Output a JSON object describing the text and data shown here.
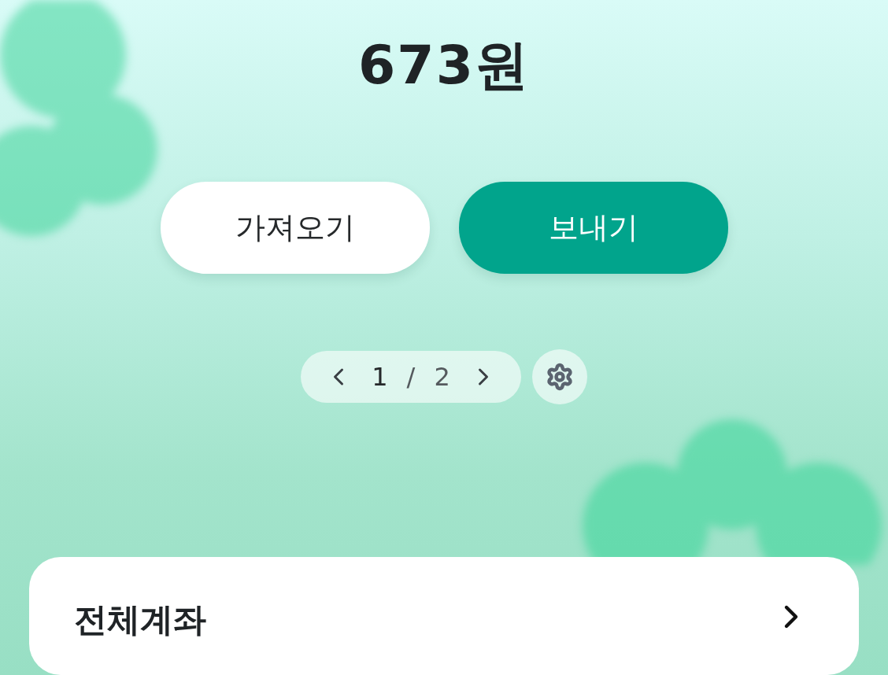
{
  "balance": {
    "amount": "673원"
  },
  "actions": [
    {
      "label": "가져오기",
      "kind": "secondary"
    },
    {
      "label": "보내기",
      "kind": "primary"
    }
  ],
  "pager": {
    "current": "1",
    "separator": "/",
    "total": "2"
  },
  "account_card": {
    "title": "전체계좌"
  }
}
